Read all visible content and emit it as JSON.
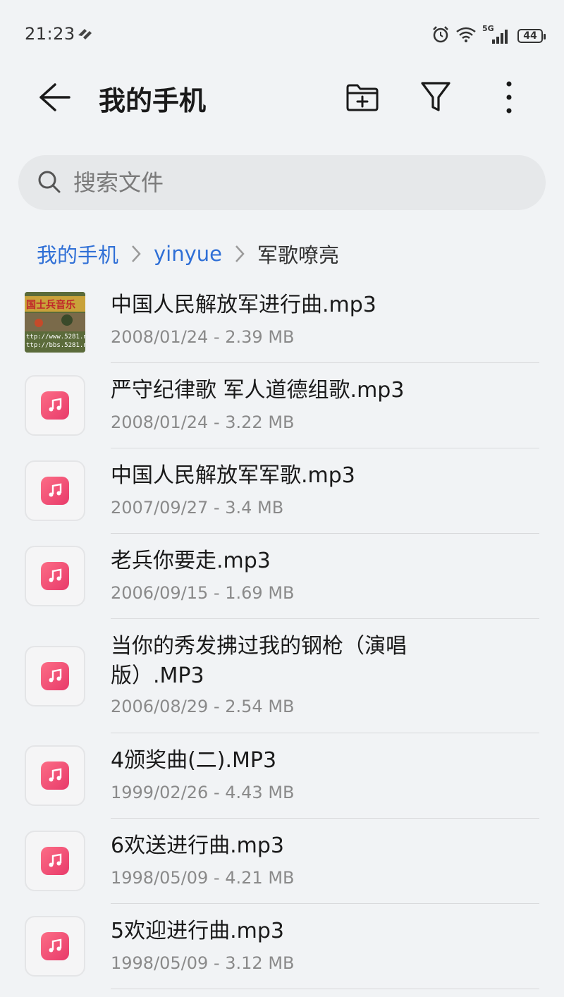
{
  "status": {
    "time": "21:23",
    "network": "5G",
    "battery": "44"
  },
  "header": {
    "title": "我的手机"
  },
  "search": {
    "placeholder": "搜索文件"
  },
  "breadcrumb": [
    {
      "label": "我的手机"
    },
    {
      "label": "yinyue"
    },
    {
      "label": "军歌嘹亮"
    }
  ],
  "files": [
    {
      "name": "中国人民解放军进行曲.mp3",
      "meta": "2008/01/24 - 2.39 MB",
      "thumb": "image-thumbnail",
      "thumb_text": "国士兵音乐",
      "thumb_url1": "ttp://www.5281.n",
      "thumb_url2": "ttp://bbs.5281.n"
    },
    {
      "name": "严守纪律歌  军人道德组歌.mp3",
      "meta": "2008/01/24 - 3.22 MB",
      "thumb": "music-note-icon"
    },
    {
      "name": "中国人民解放军军歌.mp3",
      "meta": "2007/09/27 - 3.4 MB",
      "thumb": "music-note-icon"
    },
    {
      "name": "老兵你要走.mp3",
      "meta": "2006/09/15 - 1.69 MB",
      "thumb": "music-note-icon"
    },
    {
      "name": "当你的秀发拂过我的钢枪（演唱版）.MP3",
      "meta": "2006/08/29 - 2.54 MB",
      "thumb": "music-note-icon"
    },
    {
      "name": "4颁奖曲(二).MP3",
      "meta": "1999/02/26 - 4.43 MB",
      "thumb": "music-note-icon"
    },
    {
      "name": "6欢送进行曲.mp3",
      "meta": "1998/05/09 - 4.21 MB",
      "thumb": "music-note-icon"
    },
    {
      "name": "5欢迎进行曲.mp3",
      "meta": "1998/05/09 - 3.12 MB",
      "thumb": "music-note-icon"
    }
  ],
  "colors": {
    "accent": "#2f6fd6",
    "music_icon": "#f0557a",
    "background": "#f1f3f5"
  }
}
